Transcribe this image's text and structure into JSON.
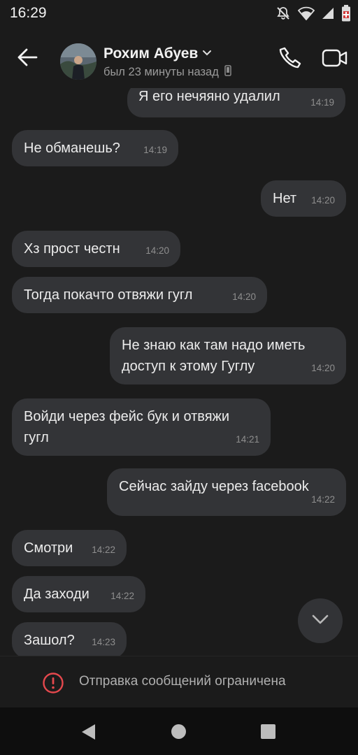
{
  "status_bar": {
    "time": "16:29",
    "icons": [
      "mute-icon",
      "wifi-icon",
      "signal-icon",
      "battery-icon"
    ]
  },
  "header": {
    "contact_name": "Рохим Абуев",
    "last_seen": "был 23 минуты назад",
    "icons": [
      "back-arrow-icon",
      "chevron-down-icon",
      "phone-device-icon",
      "phone-call-icon",
      "video-call-icon"
    ]
  },
  "messages": [
    {
      "text": "Я его нечяяно удалил",
      "time": "14:19",
      "side": "out"
    },
    {
      "text": "Не обманешь?",
      "time": "14:19",
      "side": "in"
    },
    {
      "text": "Нет",
      "time": "14:20",
      "side": "out"
    },
    {
      "text": "Хз прост честн",
      "time": "14:20",
      "side": "in"
    },
    {
      "text": "Тогда покачто отвяжи гугл",
      "time": "14:20",
      "side": "in"
    },
    {
      "text": "Не знаю как там надо иметь\nдоступ к этому Гуглу",
      "time": "14:20",
      "side": "out"
    },
    {
      "text": "Войди через фейс бук и отвяжи\nгугл",
      "time": "14:21",
      "side": "in"
    },
    {
      "text": "Сейчас зайду через facebook",
      "time": "14:22",
      "side": "out"
    },
    {
      "text": "Смотри",
      "time": "14:22",
      "side": "in"
    },
    {
      "text": "Да заходи",
      "time": "14:22",
      "side": "in"
    },
    {
      "text": "Зашол?",
      "time": "14:23",
      "side": "in"
    }
  ],
  "restriction": {
    "text": "Отправка сообщений ограничена",
    "color": "#e5484d"
  },
  "colors": {
    "background": "#1b1b1b",
    "bubble": "#333437",
    "text": "#ececec",
    "timestamp": "#8e8e8e"
  }
}
